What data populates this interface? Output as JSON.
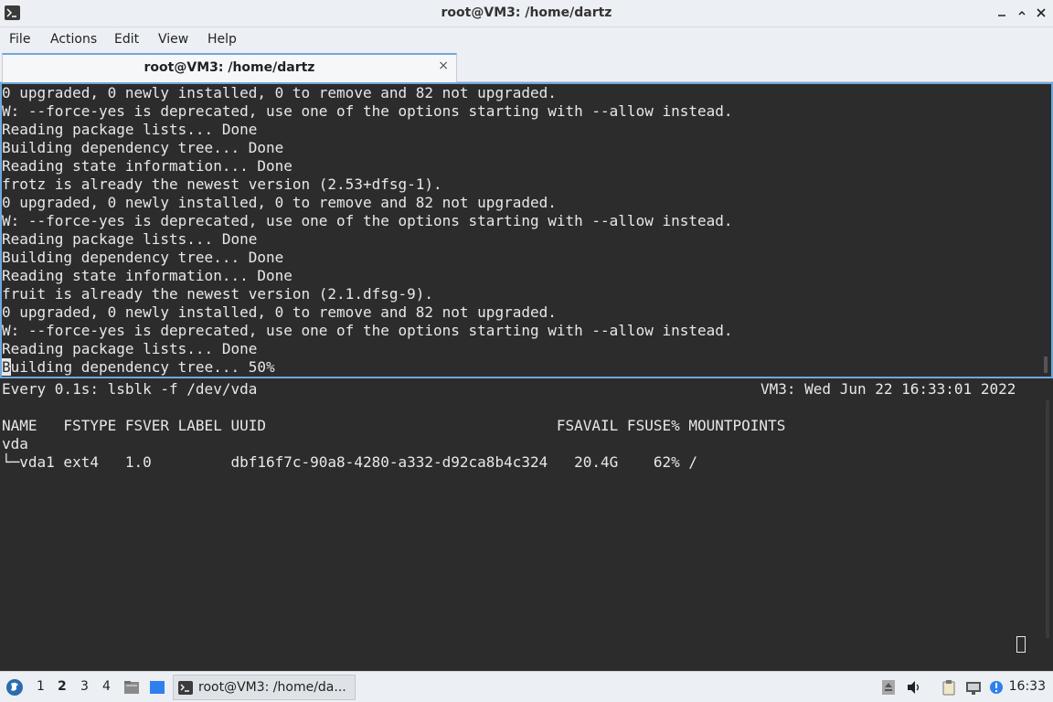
{
  "window": {
    "title": "root@VM3: /home/dartz",
    "icon": "terminal-icon",
    "controls": [
      "minimize",
      "maximize",
      "close"
    ]
  },
  "menu": [
    "File",
    "Actions",
    "Edit",
    "View",
    "Help"
  ],
  "tab": {
    "label": "root@VM3: /home/dartz",
    "close": "×"
  },
  "top_pane": {
    "lines": [
      "0 upgraded, 0 newly installed, 0 to remove and 82 not upgraded.",
      "W: --force-yes is deprecated, use one of the options starting with --allow instead.",
      "Reading package lists... Done",
      "Building dependency tree... Done",
      "Reading state information... Done",
      "frotz is already the newest version (2.53+dfsg-1).",
      "0 upgraded, 0 newly installed, 0 to remove and 82 not upgraded.",
      "W: --force-yes is deprecated, use one of the options starting with --allow instead.",
      "Reading package lists... Done",
      "Building dependency tree... Done",
      "Reading state information... Done",
      "fruit is already the newest version (2.1.dfsg-9).",
      "0 upgraded, 0 newly installed, 0 to remove and 82 not upgraded.",
      "W: --force-yes is deprecated, use one of the options starting with --allow instead.",
      "Reading package lists... Done"
    ],
    "cursor_char": "B",
    "last_line_rest": "uilding dependency tree... 50%"
  },
  "bottom_pane": {
    "watch_cmd": "Every 0.1s: lsblk -f /dev/vda",
    "watch_stamp": "VM3: Wed Jun 22 16:33:01 2022",
    "header": "NAME   FSTYPE FSVER LABEL UUID                                 FSAVAIL FSUSE% MOUNTPOINTS",
    "rows": [
      "vda",
      "└─vda1 ext4   1.0         dbf16f7c-90a8-4280-a332-d92ca8b4c324   20.4G    62% /"
    ]
  },
  "taskbar": {
    "workspaces": [
      "1",
      "2",
      "3",
      "4"
    ],
    "active_workspace": "2",
    "task_label": "root@VM3: /home/da...",
    "clock": "16:33",
    "tray_icons": [
      "upload-icon",
      "volume-icon",
      "clipboard-icon",
      "network-icon",
      "notification-icon"
    ]
  },
  "colors": {
    "terminal_bg": "#2c2c2c",
    "terminal_fg": "#e8e8e8",
    "focus_border": "#6fa8dc",
    "chrome_bg": "#eceff3"
  }
}
